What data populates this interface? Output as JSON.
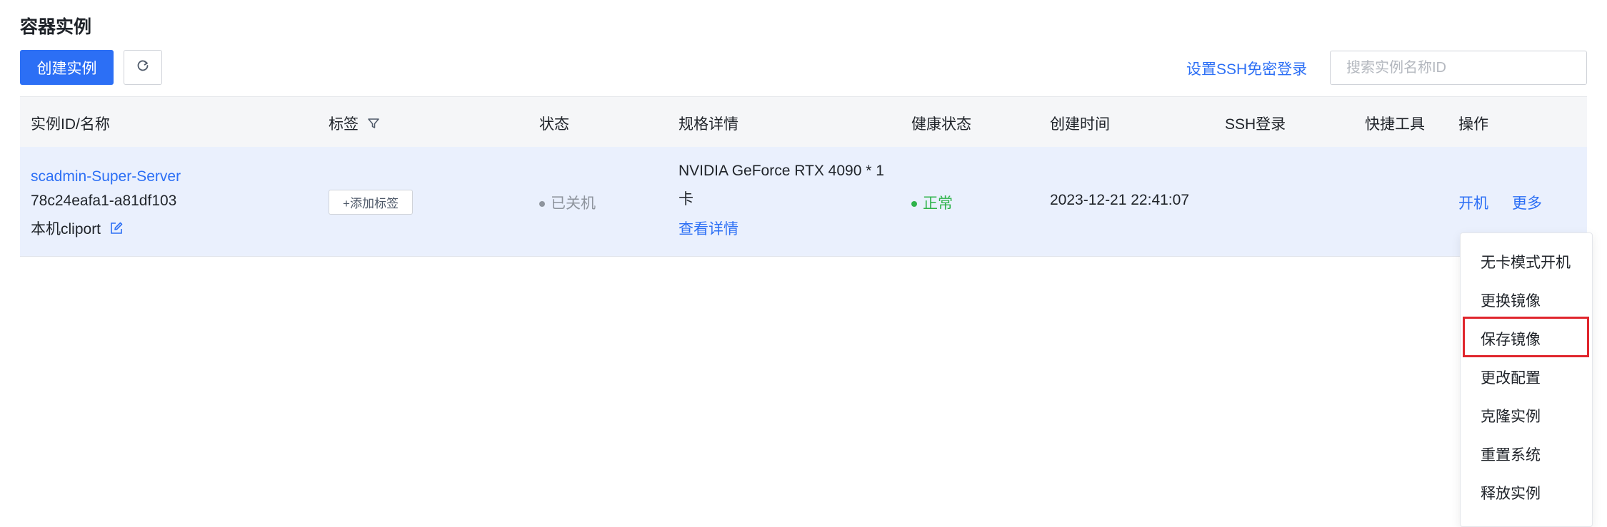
{
  "page": {
    "title": "容器实例"
  },
  "toolbar": {
    "create_label": "创建实例",
    "refresh_icon": "refresh-icon",
    "ssh_link": "设置SSH免密登录",
    "search_placeholder": "搜索实例名称ID"
  },
  "table": {
    "headers": {
      "id_name": "实例ID/名称",
      "tags": "标签",
      "status": "状态",
      "spec": "规格详情",
      "health": "健康状态",
      "created": "创建时间",
      "ssh": "SSH登录",
      "tools": "快捷工具",
      "actions": "操作"
    },
    "rows": [
      {
        "name": "scadmin-Super-Server",
        "id": "78c24eafa1-a81df103",
        "remark": "本机cliport",
        "tag_button": "+添加标签",
        "status": "已关机",
        "spec_line1": "NVIDIA GeForce RTX 4090 * 1",
        "spec_line2": "卡",
        "spec_link": "查看详情",
        "health": "正常",
        "created": "2023-12-21 22:41:07",
        "action_start": "开机",
        "action_more": "更多"
      }
    ]
  },
  "more_menu": {
    "items": [
      {
        "label": "无卡模式开机"
      },
      {
        "label": "更换镜像"
      },
      {
        "label": "保存镜像"
      },
      {
        "label": "更改配置"
      },
      {
        "label": "克隆实例"
      },
      {
        "label": "重置系统"
      },
      {
        "label": "释放实例"
      }
    ],
    "highlighted": "保存镜像"
  },
  "colors": {
    "primary": "#2c6ff5",
    "status_off": "#8f959e",
    "status_ok": "#2fb34a",
    "row_selected_bg": "#eaf0fd",
    "highlight_border": "#e0262d"
  }
}
